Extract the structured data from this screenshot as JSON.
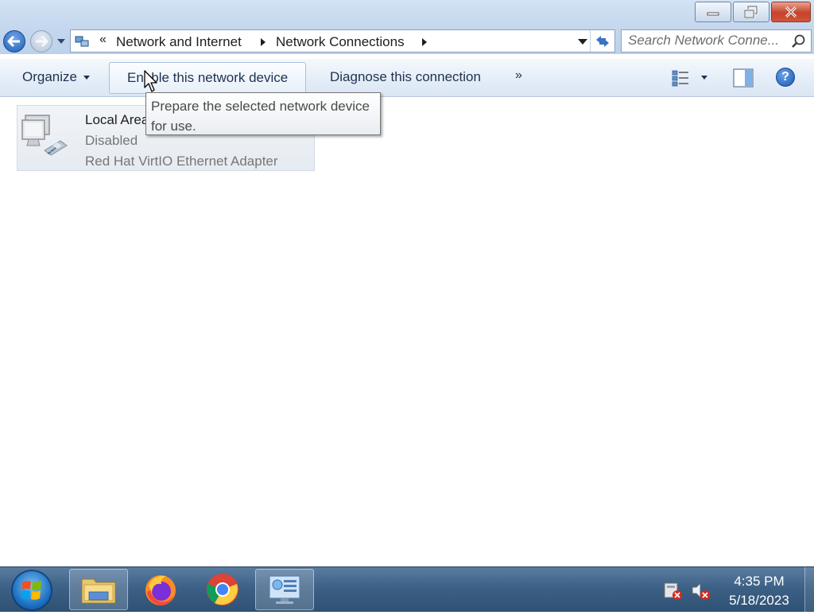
{
  "window": {
    "controls": {
      "minimize": "minimize",
      "restore": "restore",
      "close": "close"
    }
  },
  "address": {
    "overflow": "«",
    "crumbs": [
      "Network and Internet",
      "Network Connections"
    ]
  },
  "search": {
    "placeholder": "Search Network Conne..."
  },
  "toolbar": {
    "organize": "Organize",
    "enable": "Enable this network device",
    "diagnose": "Diagnose this connection",
    "more": "»"
  },
  "connection": {
    "name": "Local Area Connection",
    "name_visible": "Local Area",
    "status": "Disabled",
    "adapter": "Red Hat VirtIO Ethernet Adapter"
  },
  "tooltip": {
    "line1": "Prepare the selected network device",
    "line2": "for use."
  },
  "taskbar": {
    "time": "4:35 PM",
    "date": "5/18/2023"
  },
  "colors": {
    "accent": "#1f5fb6",
    "taskbar": "#3d6186",
    "status_text": "#767676"
  }
}
